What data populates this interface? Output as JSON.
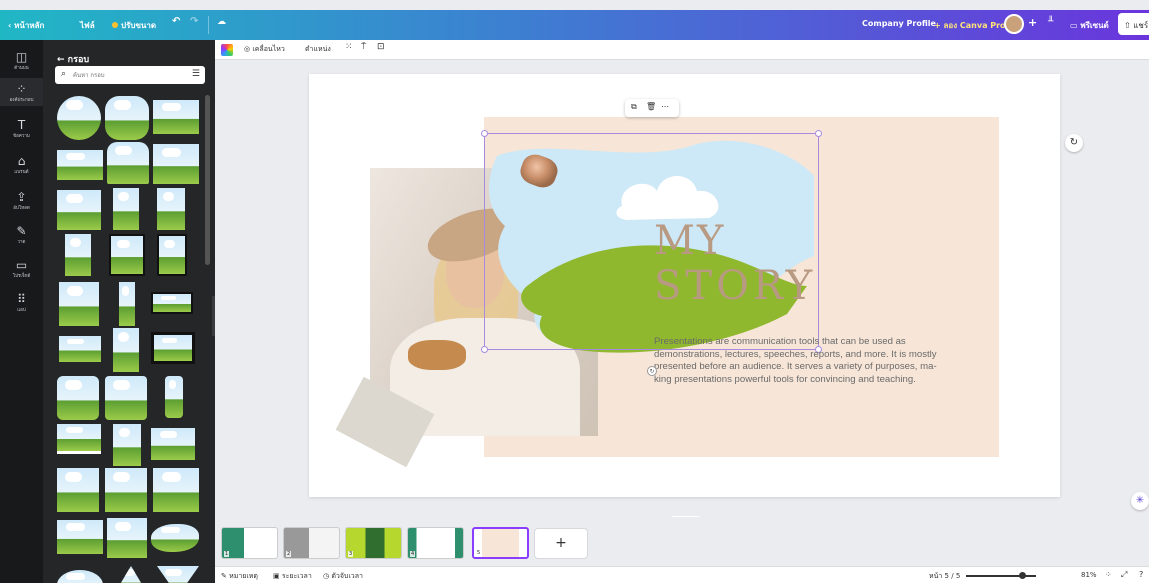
{
  "topbar": {
    "home": "‹ หน้าหลัก",
    "file": "ไฟล์",
    "resize": "ปรับขนาด",
    "undo_icon": "undo-icon",
    "redo_icon": "redo-icon",
    "cloud_icon": "cloud-sync-icon",
    "doc_title": "Company Profile",
    "try_pro": "+ ลอง Canva Pro",
    "plus": "+",
    "present": "พรีเซนต์",
    "share": "แชร์",
    "gradient_start": "#20b7c5",
    "gradient_end": "#6a35dc"
  },
  "rail": [
    {
      "label": "ด้านบน",
      "icon": "template-icon"
    },
    {
      "label": "องค์ประกอบ",
      "icon": "elements-icon"
    },
    {
      "label": "ข้อความ",
      "icon": "text-icon"
    },
    {
      "label": "แบรนด์",
      "icon": "brand-icon"
    },
    {
      "label": "อัปโหลด",
      "icon": "upload-icon"
    },
    {
      "label": "วาด",
      "icon": "draw-icon"
    },
    {
      "label": "โปรเจ็กต์",
      "icon": "folder-icon"
    },
    {
      "label": "แอป",
      "icon": "apps-icon"
    }
  ],
  "panel": {
    "title": "← กรอบ",
    "search_placeholder": "ค้นหา กรอบ"
  },
  "toolbar": {
    "animate": "เคลื่อนไหว",
    "position": "ตำแหน่ง"
  },
  "slide": {
    "title_line1": "MY",
    "title_line2": "STORY",
    "body": "Presentations are communication tools that can be used as demonstrations, lectures, speeches, reports, and more. It is mostly presented before an audience. It serves a variety of purposes, ma- king presentations powerful tools for convincing and teaching.",
    "title_color": "#b89982",
    "background_color": "#f7e6d8"
  },
  "filmstrip": {
    "pages": [
      "1",
      "2",
      "3",
      "4",
      "5"
    ],
    "add_label": "+"
  },
  "statusbar": {
    "notes": "หมายเหตุ",
    "duration": "ระยะเวลา",
    "timer": "ตัวจับเวลา",
    "page_indicator": "หน้า 5 / 5",
    "zoom": "81%",
    "zoom_fraction": 0.81
  }
}
